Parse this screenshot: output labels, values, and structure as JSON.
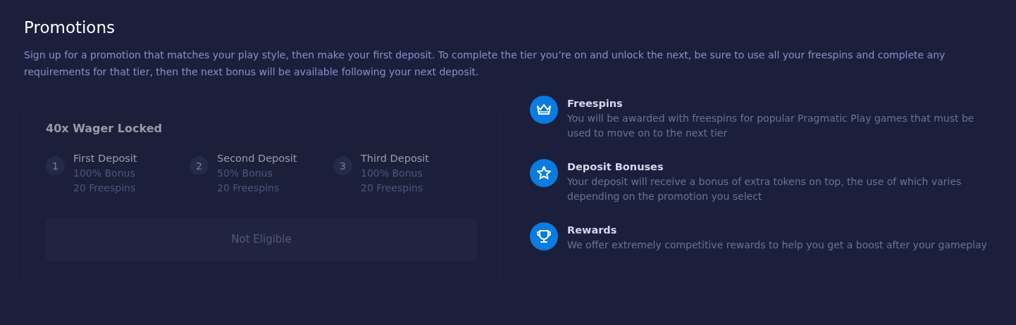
{
  "title": "Promotions",
  "description": "Sign up for a promotion that matches your play style, then make your first deposit. To complete the tier you’re on and unlock the next, be sure to use all your freespins and complete any requirements for that tier, then the next bonus will be available following your next deposit.",
  "promotion": {
    "title": "40x Wager Locked",
    "tiers": [
      {
        "number": "1",
        "name": "First Deposit",
        "bonus": "100% Bonus",
        "freespins": "20 Freespins"
      },
      {
        "number": "2",
        "name": "Second Deposit",
        "bonus": "50% Bonus",
        "freespins": "20 Freespins"
      },
      {
        "number": "3",
        "name": "Third Deposit",
        "bonus": "100% Bonus",
        "freespins": "20 Freespins"
      }
    ],
    "button": {
      "label": "Not Eligible",
      "disabled": true
    }
  },
  "features": [
    {
      "kind": "crown",
      "title": "Freespins",
      "text": "You will be awarded with freespins for popular Pragmatic Play games that must be used to move on to the next tier"
    },
    {
      "kind": "star",
      "title": "Deposit Bonuses",
      "text": "Your deposit will receive a bonus of extra tokens on top, the use of which varies depending on the promotion you select"
    },
    {
      "kind": "trophy",
      "title": "Rewards",
      "text": "We offer extremely competitive rewards to help you get a boost after your gameplay"
    }
  ]
}
